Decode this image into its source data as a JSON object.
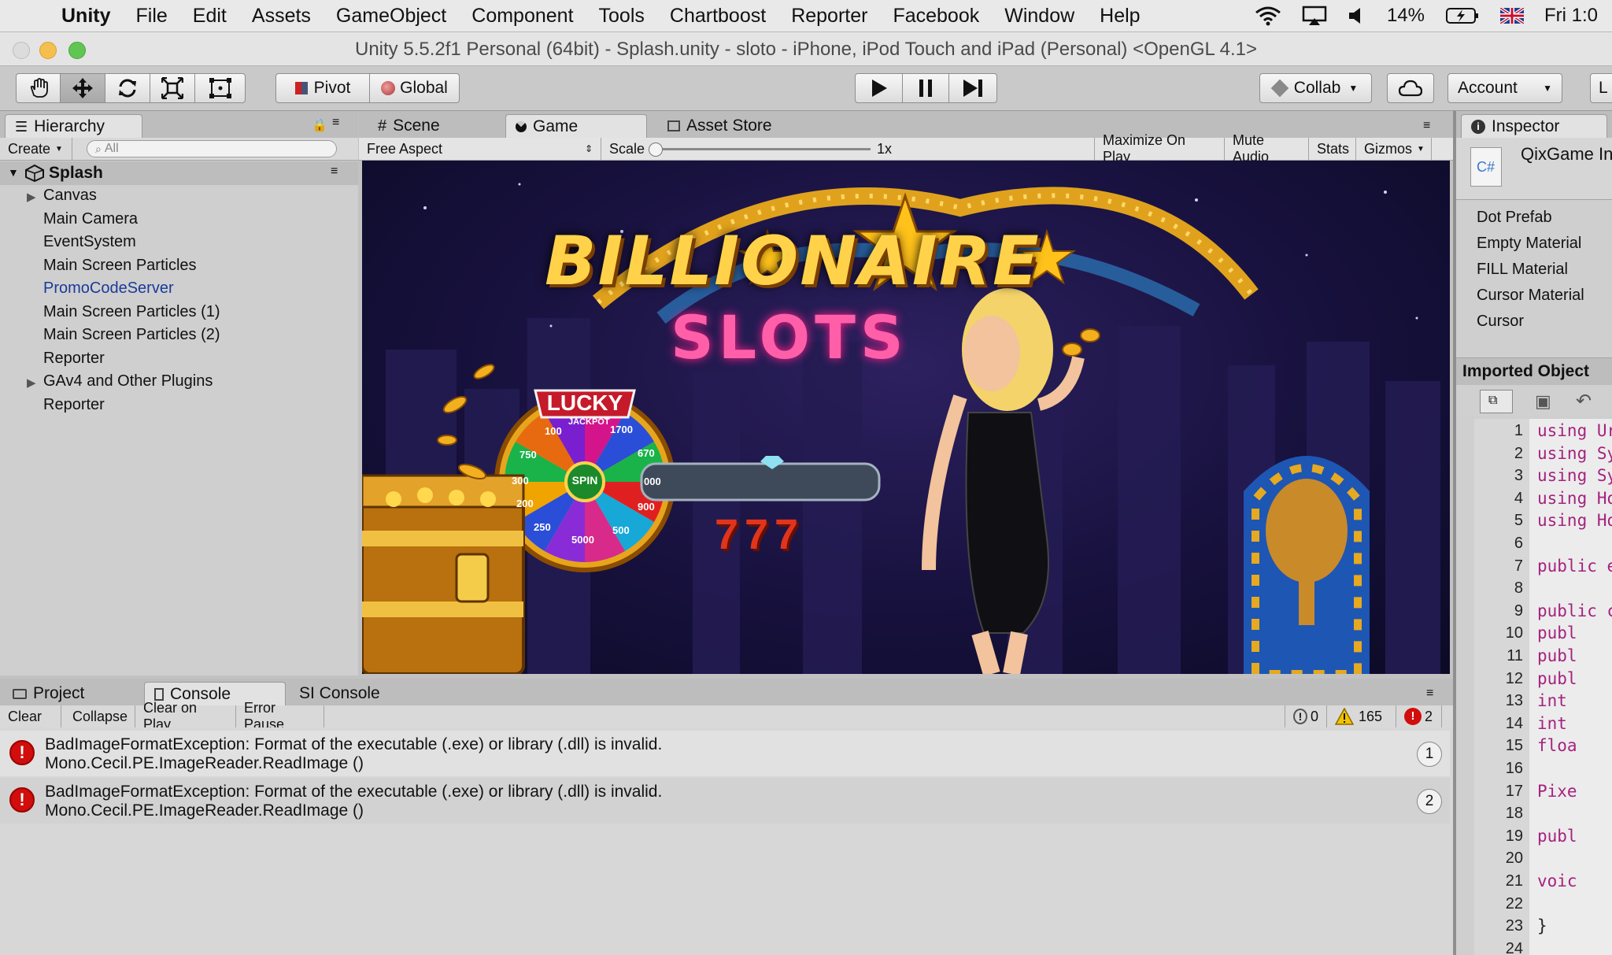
{
  "menubar": {
    "app": "Unity",
    "items": [
      "File",
      "Edit",
      "Assets",
      "GameObject",
      "Component",
      "Tools",
      "Chartboost",
      "Reporter",
      "Facebook",
      "Window",
      "Help"
    ],
    "battery": "14%",
    "clock": "Fri 1:0"
  },
  "window_title": "Unity 5.5.2f1 Personal (64bit) - Splash.unity - sloto - iPhone, iPod Touch and iPad (Personal) <OpenGL 4.1>",
  "toolbar": {
    "pivot": "Pivot",
    "global": "Global",
    "collab": "Collab",
    "account": "Account",
    "layers_partial": "L"
  },
  "hierarchy": {
    "tab": "Hierarchy",
    "create": "Create",
    "search_placeholder": "All",
    "scene": "Splash",
    "items": [
      {
        "label": "Canvas"
      },
      {
        "label": "Main Camera"
      },
      {
        "label": "EventSystem"
      },
      {
        "label": "Main Screen Particles"
      },
      {
        "label": "PromoCodeServer"
      },
      {
        "label": "Main Screen Particles (1)"
      },
      {
        "label": "Main Screen Particles (2)"
      },
      {
        "label": "Reporter"
      },
      {
        "label": "GAv4 and Other Plugins"
      },
      {
        "label": "Reporter"
      }
    ]
  },
  "viewtabs": {
    "scene": "Scene",
    "game": "Game",
    "asset_store": "Asset Store"
  },
  "gamebar": {
    "aspect": "Free Aspect",
    "scale_label": "Scale",
    "scale_value": "1x",
    "maximize": "Maximize On Play",
    "mute": "Mute Audio",
    "stats": "Stats",
    "gizmos": "Gizmos"
  },
  "game": {
    "title1": "BILLIONAIRE",
    "title2": "SLOTS",
    "lucky": "LUCKY",
    "spin": "SPIN",
    "sevens": "777",
    "wheel": [
      "JACKPOT",
      "1700",
      "670",
      "000",
      "900",
      "500",
      "5000",
      "250",
      "200",
      "300",
      "750",
      "100"
    ]
  },
  "bottomtabs": {
    "project": "Project",
    "console": "Console",
    "sl": "SI Console"
  },
  "console": {
    "clear": "Clear",
    "collapse": "Collapse",
    "clear_on_play": "Clear on Play",
    "error_pause": "Error Pause",
    "info_count": "0",
    "warn_count": "165",
    "err_count": "2",
    "rows": [
      {
        "msg": "BadImageFormatException: Format of the executable (.exe) or library (.dll) is invalid.",
        "trace": "Mono.Cecil.PE.ImageReader.ReadImage ()",
        "count": "1"
      },
      {
        "msg": "BadImageFormatException: Format of the executable (.exe) or library (.dll) is invalid.",
        "trace": "Mono.Cecil.PE.ImageReader.ReadImage ()",
        "count": "2"
      }
    ]
  },
  "inspector": {
    "tab": "Inspector",
    "object": "QixGame In",
    "items": [
      "Dot Prefab",
      "Empty Material",
      "FILL Material",
      "Cursor Material",
      "Cursor"
    ],
    "imported": "Imported Object",
    "lines": [
      "1",
      "2",
      "3",
      "4",
      "5",
      "6",
      "7",
      "8",
      "9",
      "10",
      "11",
      "12",
      "13",
      "14",
      "15",
      "16",
      "17",
      "18",
      "19",
      "20",
      "21",
      "22",
      "23",
      "24"
    ],
    "code": [
      "using Ur",
      "using Sy",
      "using Sy",
      "using Ho",
      "using Ho",
      "",
      "public e",
      "",
      "public c",
      "    publ",
      "    publ",
      "    publ",
      "    int",
      "    int",
      "    floa",
      "",
      "    Pixe",
      "",
      "    publ",
      "",
      "    voic",
      "",
      "    }",
      ""
    ]
  },
  "colors": {
    "accent": "#1a3a9a",
    "error": "#d10d0d",
    "warn": "#f2c200",
    "code_keyword": "#a5227f"
  }
}
